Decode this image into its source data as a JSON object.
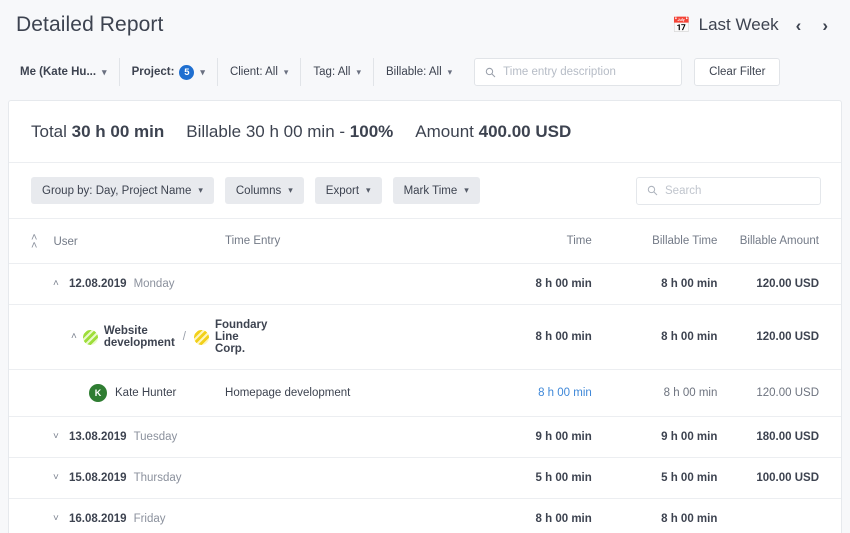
{
  "header": {
    "title": "Detailed Report",
    "date_range_label": "Last Week",
    "calendar_icon": "calendar-icon",
    "prev_label": "‹",
    "next_label": "›"
  },
  "filters": {
    "user": "Me (Kate Hu...",
    "project_label": "Project:",
    "project_count": "5",
    "client": "Client: All",
    "tag": "Tag: All",
    "billable": "Billable: All",
    "description_placeholder": "Time entry description",
    "description_value": "",
    "clear_filter_label": "Clear Filter"
  },
  "summary": {
    "total_label": "Total",
    "total_value": "30 h 00 min",
    "billable_label": "Billable",
    "billable_value": "30 h 00 min",
    "billable_sep": "-",
    "billable_percent": "100%",
    "amount_label": "Amount",
    "amount_value": "400.00 USD"
  },
  "toolbar": {
    "group_by": "Group by: Day, Project Name",
    "columns": "Columns",
    "export": "Export",
    "mark_time": "Mark Time",
    "search_placeholder": "Search",
    "search_value": ""
  },
  "table": {
    "columns": [
      "User",
      "Time Entry",
      "Time",
      "Billable Time",
      "Billable Amount"
    ],
    "rows": [
      {
        "kind": "day",
        "chevron": "˄",
        "date": "12.08.2019",
        "day": "Monday",
        "time": "8 h 00 min",
        "billable_time": "8 h 00 min",
        "billable_amount": "120.00 USD"
      },
      {
        "kind": "project",
        "chevron": "˄",
        "project": "Website development",
        "separator": "/",
        "client": "Foundary Line Corp.",
        "time": "8 h 00 min",
        "billable_time": "8 h 00 min",
        "billable_amount": "120.00 USD"
      },
      {
        "kind": "entry",
        "avatar_initial": "K",
        "user": "Kate Hunter",
        "entry": "Homepage development",
        "time": "8 h 00 min",
        "billable_time": "8 h 00 min",
        "billable_amount": "120.00 USD"
      },
      {
        "kind": "day",
        "chevron": "˅",
        "date": "13.08.2019",
        "day": "Tuesday",
        "time": "9 h 00 min",
        "billable_time": "9 h 00 min",
        "billable_amount": "180.00 USD"
      },
      {
        "kind": "day",
        "chevron": "˅",
        "date": "15.08.2019",
        "day": "Thursday",
        "time": "5 h 00 min",
        "billable_time": "5 h 00 min",
        "billable_amount": "100.00 USD"
      },
      {
        "kind": "day",
        "chevron": "˅",
        "date": "16.08.2019",
        "day": "Friday",
        "time": "8 h 00 min",
        "billable_time": "8 h 00 min",
        "billable_amount": ""
      }
    ]
  },
  "colors": {
    "accent_blue": "#1f6fd0",
    "link_blue": "#3f88d8",
    "project_green": "#9ede3a",
    "client_yellow": "#f2d01a",
    "avatar_green": "#2f7d32",
    "page_bg": "#f7f8fa"
  }
}
